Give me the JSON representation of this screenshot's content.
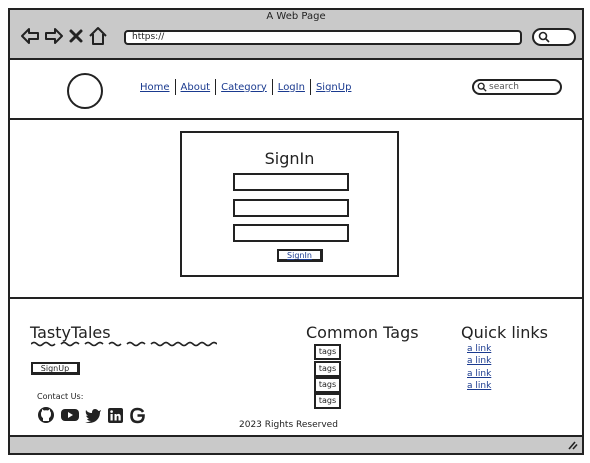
{
  "browser": {
    "title": "A Web Page",
    "url": "https://"
  },
  "nav": {
    "items": [
      {
        "label": "Home"
      },
      {
        "label": "About"
      },
      {
        "label": "Category"
      },
      {
        "label": "LogIn"
      },
      {
        "label": "SignUp"
      }
    ],
    "search_placeholder": "search"
  },
  "signin": {
    "title": "SignIn",
    "button": "SignIn"
  },
  "footer": {
    "brand": "TastyTales",
    "signup": "SignUp",
    "contact": "Contact Us:",
    "social_icons": [
      "github-icon",
      "youtube-icon",
      "twitter-icon",
      "linkedin-icon",
      "google-icon"
    ],
    "tags_title": "Common Tags",
    "tags": [
      "tags",
      "tags",
      "tags",
      "tags"
    ],
    "quick_title": "Quick links",
    "links": [
      "a link",
      "a link",
      "a link",
      "a link"
    ],
    "copyright": "2023 Rights Reserved"
  }
}
